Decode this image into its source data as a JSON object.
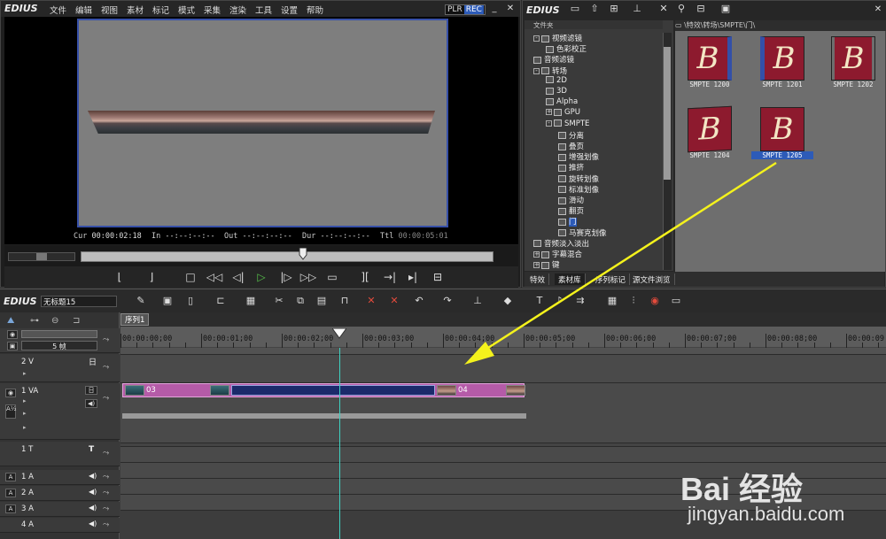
{
  "player": {
    "app_logo": "EDIUS",
    "menu": [
      "文件",
      "编辑",
      "视图",
      "素材",
      "标记",
      "模式",
      "采集",
      "渲染",
      "工具",
      "设置",
      "帮助"
    ],
    "plr_label": "PLR",
    "rec_label": "REC",
    "cur_label": "Cur",
    "cur_value": "00:00:02:18",
    "in_label": "In",
    "in_value": "--:--:--:--",
    "out_label": "Out",
    "out_value": "--:--:--:--",
    "dur_label": "Dur",
    "dur_value": "--:--:--:--",
    "ttl_label": "Ttl",
    "ttl_value": "00:00:05:01"
  },
  "bin": {
    "app_logo": "EDIUS",
    "tree_header": "文件夹",
    "path": "\\特效\\转场\\SMPTE\\门\\",
    "tree": [
      {
        "label": "视频滤镜",
        "exp": "-",
        "indent": 0
      },
      {
        "label": "色彩校正",
        "exp": "",
        "indent": 1
      },
      {
        "label": "音频滤镜",
        "exp": "",
        "indent": 0
      },
      {
        "label": "转场",
        "exp": "-",
        "indent": 0
      },
      {
        "label": "2D",
        "exp": "",
        "indent": 1
      },
      {
        "label": "3D",
        "exp": "",
        "indent": 1
      },
      {
        "label": "Alpha",
        "exp": "",
        "indent": 1
      },
      {
        "label": "GPU",
        "exp": "+",
        "indent": 1
      },
      {
        "label": "SMPTE",
        "exp": "-",
        "indent": 1
      },
      {
        "label": "分离",
        "exp": "",
        "indent": 2
      },
      {
        "label": "叠页",
        "exp": "",
        "indent": 2
      },
      {
        "label": "增强划像",
        "exp": "",
        "indent": 2
      },
      {
        "label": "推挤",
        "exp": "",
        "indent": 2
      },
      {
        "label": "旋转划像",
        "exp": "",
        "indent": 2
      },
      {
        "label": "标准划像",
        "exp": "",
        "indent": 2
      },
      {
        "label": "滑动",
        "exp": "",
        "indent": 2
      },
      {
        "label": "翻页",
        "exp": "",
        "indent": 2
      },
      {
        "label": "门",
        "exp": "",
        "indent": 2,
        "selected": true
      },
      {
        "label": "马赛克划像",
        "exp": "",
        "indent": 2
      },
      {
        "label": "音频淡入淡出",
        "exp": "",
        "indent": 0
      },
      {
        "label": "字幕混合",
        "exp": "+",
        "indent": 0
      },
      {
        "label": "键",
        "exp": "+",
        "indent": 0
      }
    ],
    "clips": [
      {
        "name": "SMPTE 1200",
        "glyph": "B"
      },
      {
        "name": "SMPTE 1201",
        "glyph": "B"
      },
      {
        "name": "SMPTE 1202",
        "glyph": "B"
      },
      {
        "name": "SMPTE 1204",
        "glyph": "B"
      },
      {
        "name": "SMPTE 1205",
        "glyph": "B",
        "selected": true
      }
    ],
    "tabs": [
      "特效",
      "素材库",
      "序列标记",
      "源文件浏览"
    ]
  },
  "timeline": {
    "app_logo": "EDIUS",
    "title": "无标题15",
    "sequence_tab": "序列1",
    "zoom_label": "5 帧",
    "ruler": [
      "00:00:00;00",
      "00:00:01;00",
      "00:00:02;00",
      "00:00:03;00",
      "00:00:04;00",
      "00:00:05;00",
      "00:00:06;00",
      "00:00:07;00",
      "00:00:08;00",
      "00:00:09"
    ],
    "tracks": {
      "v2": "2 V",
      "va1": "1 VA",
      "t1": "1 T",
      "a1": "1 A",
      "a2": "2 A",
      "a3": "3 A",
      "a4": "4 A"
    },
    "clip_a": "03",
    "clip_b": "04"
  },
  "watermark": {
    "brand": "Bai 经验",
    "url": "jingyan.baidu.com"
  },
  "colors": {
    "accent_blue": "#2d5bb8",
    "clip_magenta": "#b55ba8",
    "playhead_cyan": "#3fd3c3",
    "arrow_yellow": "#f4f21c",
    "thumb_red": "#8d1a2e"
  }
}
